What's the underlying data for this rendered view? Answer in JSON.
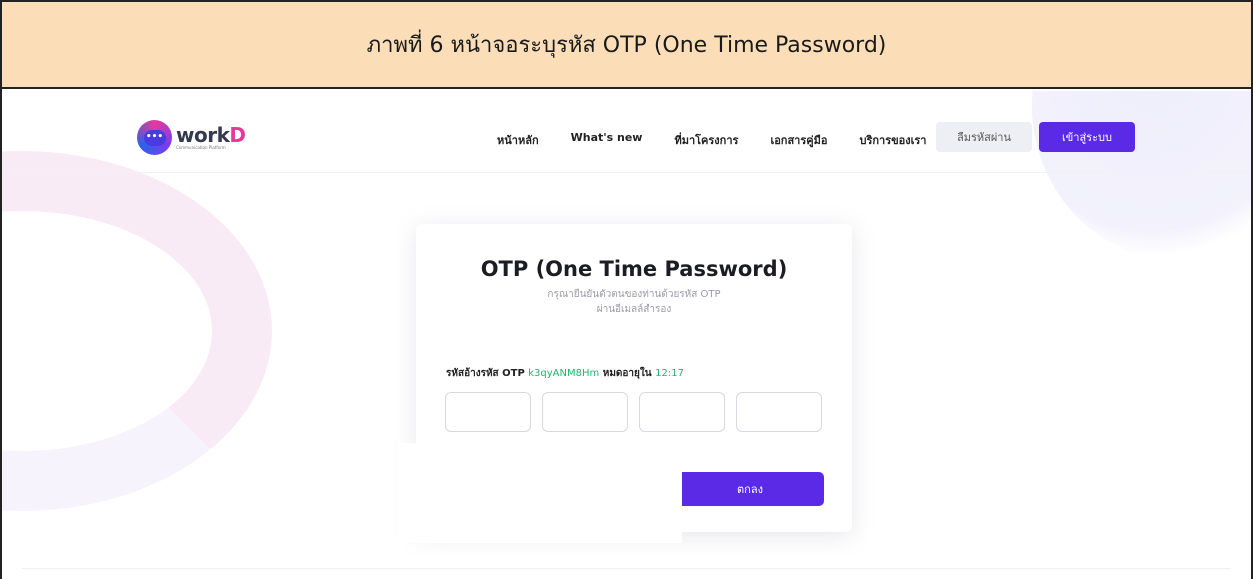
{
  "caption": "ภาพที่ 6 หน้าจอระบุรหัส OTP (One Time Password)",
  "brand": {
    "logo_icon": "•••",
    "name_main": "work",
    "name_accent": "D",
    "tagline": "Communication Platform"
  },
  "nav": {
    "items": [
      {
        "label": "หน้าหลัก"
      },
      {
        "label": "What's new"
      },
      {
        "label": "ที่มาโครงการ"
      },
      {
        "label": "เอกสารคู่มือ"
      },
      {
        "label": "บริการของเรา"
      }
    ],
    "forgot_password": "ลืมรหัสผ่าน",
    "login": "เข้าสู่ระบบ"
  },
  "otp": {
    "title": "OTP (One Time Password)",
    "subtitle_line1": "กรุณายืนยันตัวตนของท่านด้วยรหัส OTP",
    "subtitle_line2": "ผ่านอีเมลล์สำรอง",
    "ref_label": "รหัสอ้างรหัส OTP",
    "ref_code": "k3qyANM8Hm",
    "expire_label": "หมดอายุใน",
    "expire_time": "12:17",
    "inputs": [
      "",
      "",
      "",
      ""
    ],
    "submit": "ตกลง"
  },
  "colors": {
    "caption_bg": "#fbdeb8",
    "primary": "#5b2ae7",
    "highlight": "#24b36b"
  }
}
